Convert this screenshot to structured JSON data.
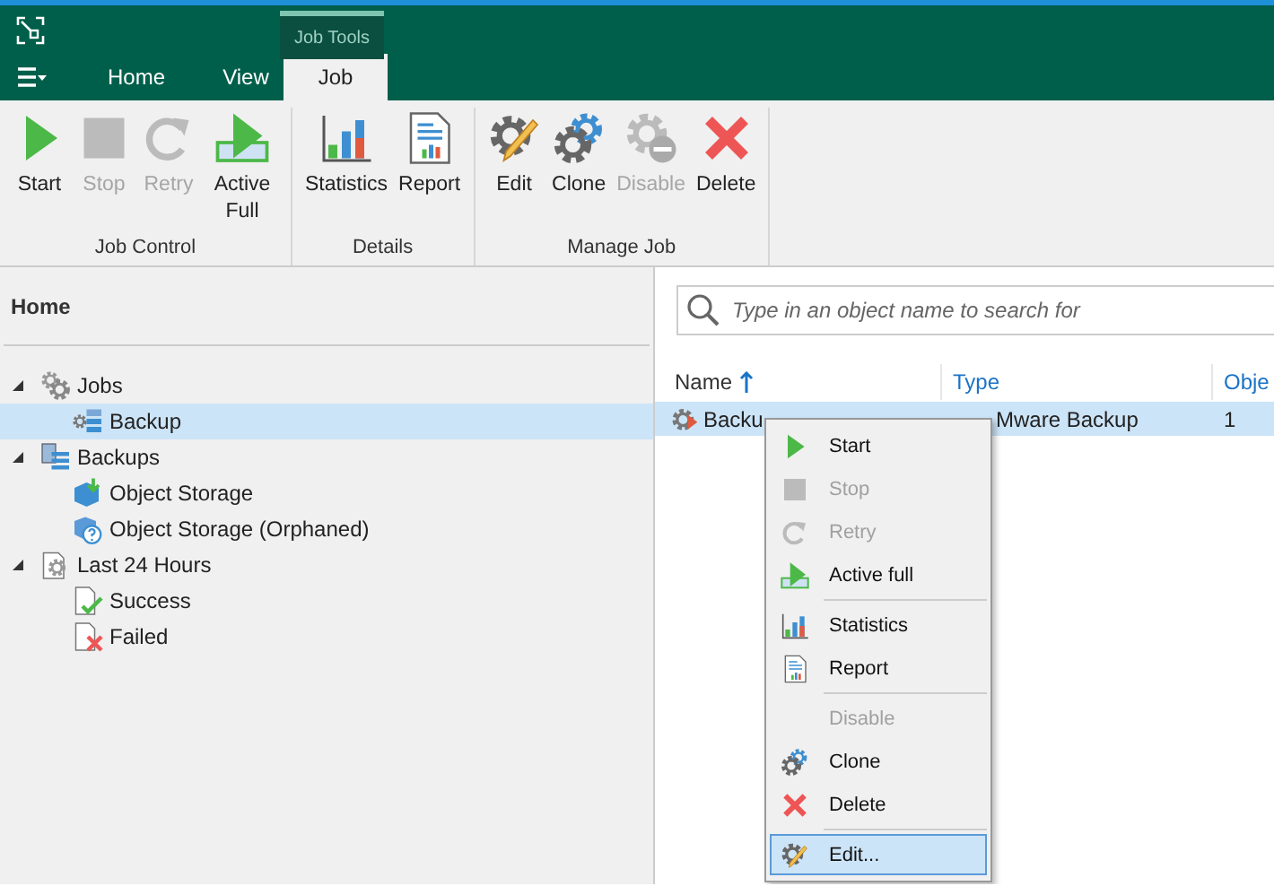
{
  "app": {
    "contextual_tab_group": "Job Tools"
  },
  "tabs": [
    {
      "label": "Home",
      "selected": false
    },
    {
      "label": "View",
      "selected": false
    },
    {
      "label": "Job",
      "selected": true
    }
  ],
  "ribbon_groups": [
    {
      "label": "Job Control",
      "buttons": [
        {
          "kind": "start",
          "label": "Start",
          "disabled": false
        },
        {
          "kind": "stop",
          "label": "Stop",
          "disabled": true
        },
        {
          "kind": "retry",
          "label": "Retry",
          "disabled": true
        },
        {
          "kind": "active_full",
          "label": "Active Full",
          "disabled": false
        }
      ]
    },
    {
      "label": "Details",
      "buttons": [
        {
          "kind": "statistics",
          "label": "Statistics",
          "disabled": false
        },
        {
          "kind": "report",
          "label": "Report",
          "disabled": false
        }
      ]
    },
    {
      "label": "Manage Job",
      "buttons": [
        {
          "kind": "edit",
          "label": "Edit",
          "disabled": false
        },
        {
          "kind": "clone",
          "label": "Clone",
          "disabled": false
        },
        {
          "kind": "disable",
          "label": "Disable",
          "disabled": true
        },
        {
          "kind": "delete",
          "label": "Delete",
          "disabled": false
        }
      ]
    }
  ],
  "sidebar": {
    "title": "Home",
    "tree": [
      {
        "kind": "jobs",
        "label": "Jobs",
        "expanded": true,
        "selected": false,
        "children": [
          {
            "kind": "backup_job",
            "label": "Backup",
            "selected": true
          }
        ]
      },
      {
        "kind": "backups",
        "label": "Backups",
        "expanded": true,
        "selected": false,
        "children": [
          {
            "kind": "object_storage",
            "label": "Object Storage",
            "selected": false
          },
          {
            "kind": "orphaned",
            "label": "Object Storage (Orphaned)",
            "selected": false
          }
        ]
      },
      {
        "kind": "last24",
        "label": "Last 24 Hours",
        "expanded": true,
        "selected": false,
        "children": [
          {
            "kind": "success",
            "label": "Success",
            "selected": false
          },
          {
            "kind": "failed",
            "label": "Failed",
            "selected": false
          }
        ]
      }
    ]
  },
  "search": {
    "placeholder": "Type in an object name to search for"
  },
  "table": {
    "columns": [
      {
        "label": "Name",
        "sorted": true
      },
      {
        "label": "Type"
      },
      {
        "label": "Obje"
      }
    ],
    "rows": [
      {
        "selected": true,
        "cells": [
          "Backu",
          "Mware Backup",
          "1"
        ]
      }
    ]
  },
  "context_menu": {
    "groups": [
      [
        {
          "kind": "start",
          "label": "Start",
          "disabled": false,
          "selected": false
        },
        {
          "kind": "stop",
          "label": "Stop",
          "disabled": true,
          "selected": false
        },
        {
          "kind": "retry",
          "label": "Retry",
          "disabled": true,
          "selected": false
        },
        {
          "kind": "active_full",
          "label": "Active full",
          "disabled": false,
          "selected": false
        }
      ],
      [
        {
          "kind": "statistics",
          "label": "Statistics",
          "disabled": false,
          "selected": false
        },
        {
          "kind": "report",
          "label": "Report",
          "disabled": false,
          "selected": false
        }
      ],
      [
        {
          "kind": "none",
          "label": "Disable",
          "disabled": true,
          "selected": false
        },
        {
          "kind": "clone",
          "label": "Clone",
          "disabled": false,
          "selected": false
        },
        {
          "kind": "delete",
          "label": "Delete",
          "disabled": false,
          "selected": false
        }
      ],
      [
        {
          "kind": "edit",
          "label": "Edit...",
          "disabled": false,
          "selected": true
        }
      ]
    ]
  }
}
